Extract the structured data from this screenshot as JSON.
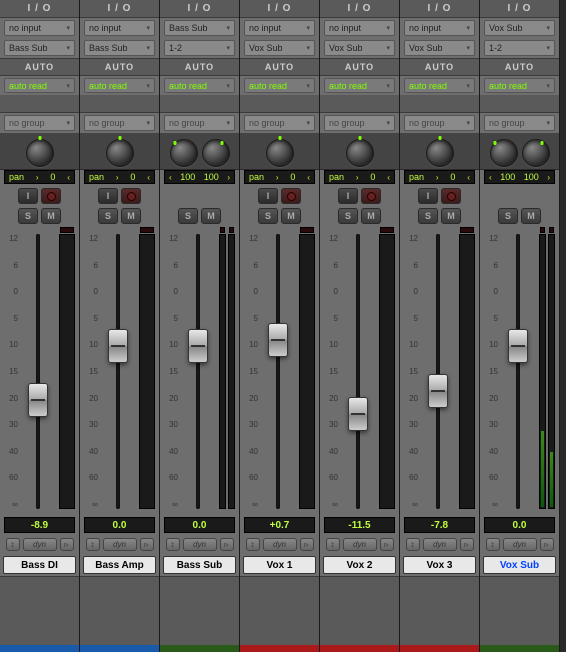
{
  "headers": {
    "io": "I / O",
    "auto": "AUTO"
  },
  "labels": {
    "auto_read": "auto read",
    "no_group": "no group",
    "pan": "pan",
    "dyn": "dyn"
  },
  "scale": [
    "12",
    "6",
    "0",
    "5",
    "10",
    "15",
    "20",
    "30",
    "40",
    "60",
    "∞"
  ],
  "channels": [
    {
      "name": "Bass DI",
      "input": "no input",
      "output": "Bass Sub",
      "pan_type": "mono",
      "pan_val": "0",
      "has_rec": true,
      "fader_pct": 54,
      "db": "-8.9",
      "meter_h": [
        0
      ],
      "color": "blue",
      "selected": false
    },
    {
      "name": "Bass Amp",
      "input": "no input",
      "output": "Bass Sub",
      "pan_type": "mono",
      "pan_val": "0",
      "has_rec": true,
      "fader_pct": 35,
      "db": "0.0",
      "meter_h": [
        0
      ],
      "color": "blue",
      "selected": false
    },
    {
      "name": "Bass Sub",
      "input": "Bass Sub",
      "output": "1-2",
      "pan_type": "stereo",
      "pan_l": "100",
      "pan_r": "100",
      "has_rec": false,
      "fader_pct": 35,
      "db": "0.0",
      "meter_h": [
        0,
        0
      ],
      "color": "green",
      "selected": false
    },
    {
      "name": "Vox 1",
      "input": "no input",
      "output": "Vox Sub",
      "pan_type": "mono",
      "pan_val": "0",
      "has_rec": true,
      "fader_pct": 33,
      "db": "+0.7",
      "meter_h": [
        0
      ],
      "color": "red",
      "selected": false
    },
    {
      "name": "Vox 2",
      "input": "no input",
      "output": "Vox Sub",
      "pan_type": "mono",
      "pan_val": "0",
      "has_rec": true,
      "fader_pct": 59,
      "db": "-11.5",
      "meter_h": [
        0
      ],
      "color": "red",
      "selected": false
    },
    {
      "name": "Vox 3",
      "input": "no input",
      "output": "Vox Sub",
      "pan_type": "mono",
      "pan_val": "0",
      "has_rec": true,
      "fader_pct": 51,
      "db": "-7.8",
      "meter_h": [
        0
      ],
      "color": "red",
      "selected": false
    },
    {
      "name": "Vox Sub",
      "input": "Vox Sub",
      "output": "1-2",
      "pan_type": "stereo",
      "pan_l": "100",
      "pan_r": "100",
      "has_rec": false,
      "fader_pct": 35,
      "db": "0.0",
      "meter_h": [
        28,
        20
      ],
      "color": "dgreen",
      "selected": true
    }
  ]
}
